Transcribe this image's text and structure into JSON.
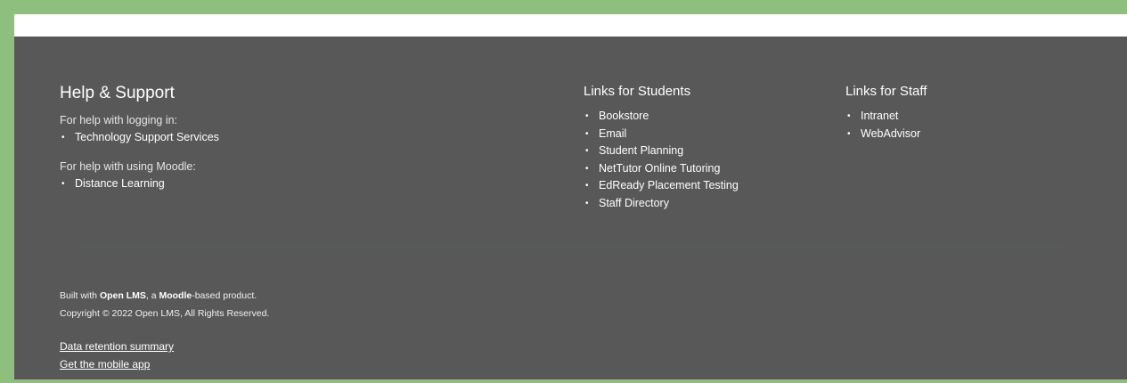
{
  "help": {
    "title": "Help & Support",
    "login_text": "For help with logging in:",
    "login_link": "Technology Support Services",
    "moodle_text": "For help with using Moodle:",
    "moodle_link": "Distance Learning"
  },
  "students": {
    "title": "Links for Students",
    "items": [
      "Bookstore",
      "Email",
      "Student Planning",
      "NetTutor Online Tutoring",
      "EdReady Placement Testing",
      "Staff Directory"
    ]
  },
  "staff": {
    "title": "Links for Staff",
    "items": [
      "Intranet",
      "WebAdvisor"
    ]
  },
  "credits": {
    "built_prefix": "Built with ",
    "built_brand": "Open LMS",
    "built_mid": ", a ",
    "built_moodle": "Moodle",
    "built_suffix": "-based product.",
    "copyright": "Copyright © 2022 Open LMS, All Rights Reserved."
  },
  "bottom_links": {
    "data_retention": "Data retention summary",
    "mobile_app": "Get the mobile app"
  },
  "bullet": "•",
  "colors": {
    "frame": "#8fbf7f",
    "footer_bg": "#585858",
    "text": "#ffffff"
  }
}
